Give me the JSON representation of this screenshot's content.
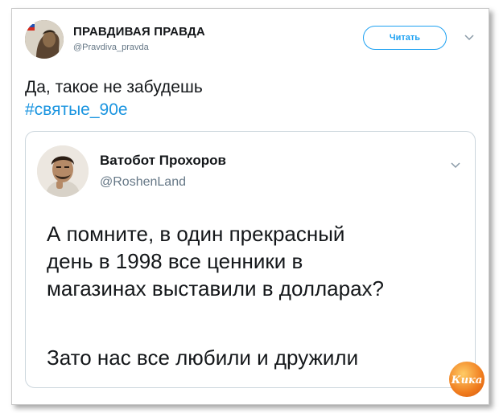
{
  "tweet": {
    "author_name": "ПРАВДИВАЯ ПРАВДА",
    "author_handle": "@Pravdiva_pravda",
    "follow_label": "Читать",
    "text": "Да, такое не забудешь",
    "hashtag": "#святые_90е"
  },
  "quoted_tweet": {
    "author_name": "Ватобот Прохоров",
    "author_handle": "@RoshenLand",
    "body_line1": "А помните, в один прекрасный",
    "body_line2": "день в 1998 все ценники в",
    "body_line3": "магазинах выставили в долларах?",
    "body_line4": "Зато нас все любили и дружили"
  },
  "watermark": {
    "text": "Кика",
    "color": "#f07c1e"
  },
  "colors": {
    "accent": "#1da1f2",
    "hashtag": "#1b95e0",
    "muted": "#657786"
  }
}
